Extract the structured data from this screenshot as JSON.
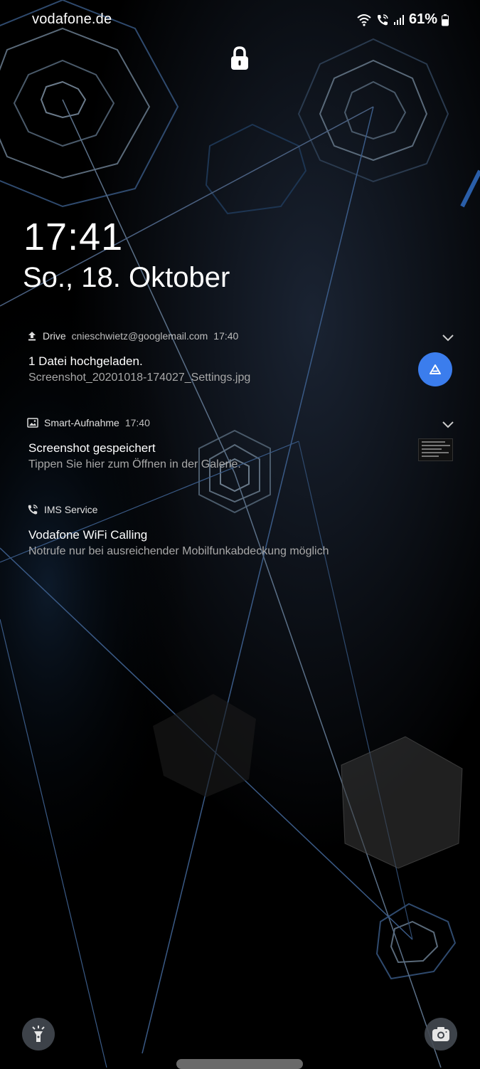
{
  "status_bar": {
    "carrier": "vodafone.de",
    "battery_percent": "61%",
    "icons": [
      "wifi-icon",
      "wifi-calling-icon",
      "signal-icon",
      "battery-icon"
    ]
  },
  "lock_icon": "lock-icon",
  "lockscreen": {
    "time": "17:41",
    "date": "So., 18. Oktober"
  },
  "notifications": [
    {
      "icon": "upload-icon",
      "app": "Drive",
      "account": "cnieschwietz@googlemail.com",
      "time": "17:40",
      "title": "1 Datei hochgeladen.",
      "text": "Screenshot_20201018-174027_Settings.jpg",
      "action_icon": "drive-icon"
    },
    {
      "icon": "image-icon",
      "app": "Smart-Aufnahme",
      "time": "17:40",
      "title": "Screenshot gespeichert",
      "text": "Tippen Sie hier zum Öffnen in der Galerie."
    },
    {
      "icon": "wifi-calling-icon",
      "app": "IMS Service",
      "title": "Vodafone WiFi Calling",
      "text": "Notrufe nur bei ausreichender Mobilfunkabdeckung möglich"
    }
  ],
  "shortcuts": {
    "left": "flashlight-icon",
    "right": "camera-icon"
  },
  "colors": {
    "background": "#000000",
    "wallpaper_lines": "#3a6fb0",
    "drive_button": "#3b7ded"
  }
}
